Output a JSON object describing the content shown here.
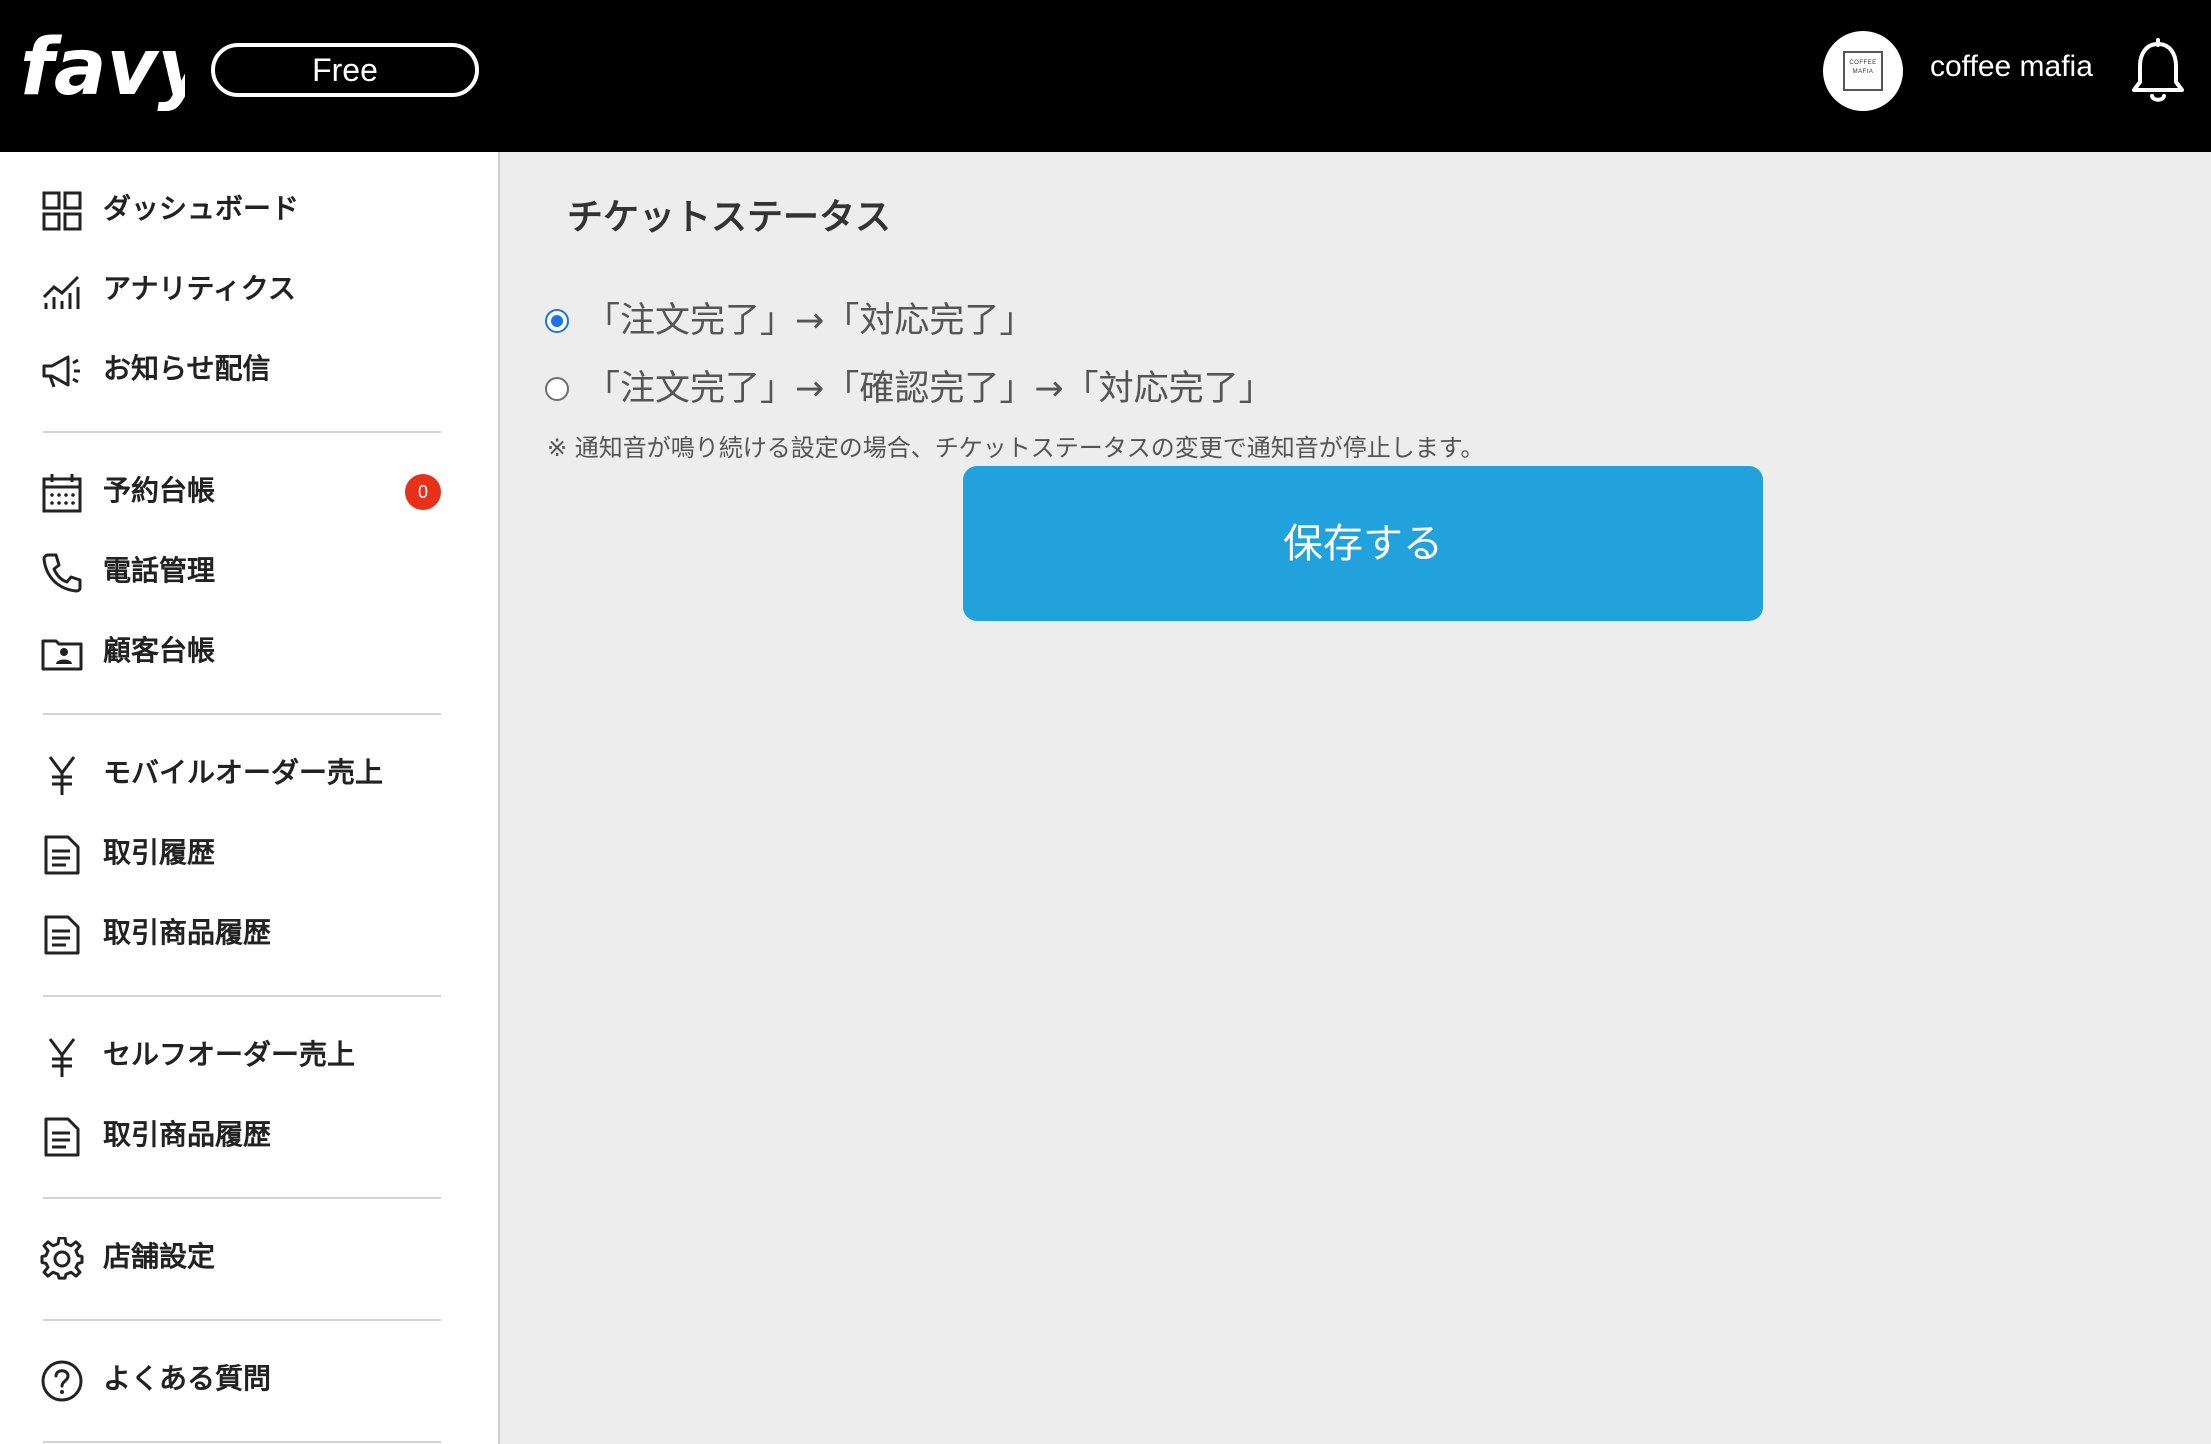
{
  "header": {
    "logo_text": "favy",
    "plan": "Free",
    "avatar_text": "COFFEE MAFIA",
    "shop_name": "coffee mafia"
  },
  "sidebar": {
    "items": [
      {
        "label": "ダッシュボード",
        "icon": "grid-icon"
      },
      {
        "label": "アナリティクス",
        "icon": "analytics-icon"
      },
      {
        "label": "お知らせ配信",
        "icon": "megaphone-icon"
      },
      {
        "label": "予約台帳",
        "icon": "calendar-icon",
        "badge": "0"
      },
      {
        "label": "電話管理",
        "icon": "phone-icon"
      },
      {
        "label": "顧客台帳",
        "icon": "contact-folder-icon"
      },
      {
        "label": "モバイルオーダー売上",
        "icon": "yen-icon"
      },
      {
        "label": "取引履歴",
        "icon": "document-icon"
      },
      {
        "label": "取引商品履歴",
        "icon": "document-icon"
      },
      {
        "label": "セルフオーダー売上",
        "icon": "yen-icon"
      },
      {
        "label": "取引商品履歴",
        "icon": "document-icon"
      },
      {
        "label": "店舗設定",
        "icon": "gear-icon"
      },
      {
        "label": "よくある質問",
        "icon": "question-icon"
      }
    ]
  },
  "main": {
    "title": "チケットステータス",
    "options": [
      {
        "label": "「注文完了」→「対応完了」",
        "checked": true
      },
      {
        "label": "「注文完了」→「確認完了」→「対応完了」",
        "checked": false
      }
    ],
    "note": "※ 通知音が鳴り続ける設定の場合、チケットステータスの変更で通知音が停止します。",
    "save_label": "保存する"
  },
  "colors": {
    "accent": "#22a2dc",
    "radio": "#1a73e8",
    "badge": "#e9301b",
    "header_bg": "#000000",
    "content_bg": "#ededed"
  }
}
